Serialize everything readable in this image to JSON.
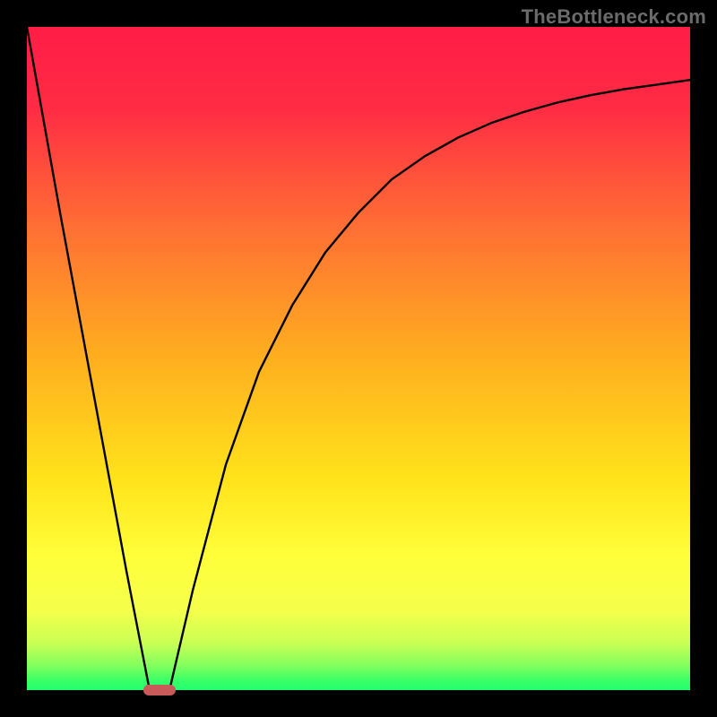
{
  "attribution": "TheBottleneck.com",
  "colors": {
    "frame": "#000000",
    "gradient_stops": [
      "#ff1f47",
      "#ff8a2a",
      "#ffd21f",
      "#ffff4a",
      "#3bff66"
    ],
    "curve": "#000000",
    "marker": "#c85a5a"
  },
  "chart_data": {
    "type": "line",
    "title": "",
    "xlabel": "",
    "ylabel": "",
    "xlim": [
      0,
      100
    ],
    "ylim": [
      0,
      100
    ],
    "series": [
      {
        "name": "bottleneck-curve",
        "x": [
          0,
          5,
          10,
          15,
          18.5,
          20,
          21.5,
          25,
          30,
          35,
          40,
          45,
          50,
          55,
          60,
          65,
          70,
          75,
          80,
          85,
          90,
          95,
          100
        ],
        "values": [
          100,
          72,
          45,
          18,
          0,
          0,
          0,
          15,
          34,
          48,
          58,
          66,
          72,
          77,
          80.5,
          83.3,
          85.5,
          87.2,
          88.6,
          89.7,
          90.6,
          91.3,
          92
        ]
      }
    ],
    "annotations": [
      {
        "name": "optimal-marker",
        "x": 20,
        "y": 0,
        "shape": "pill"
      }
    ]
  }
}
